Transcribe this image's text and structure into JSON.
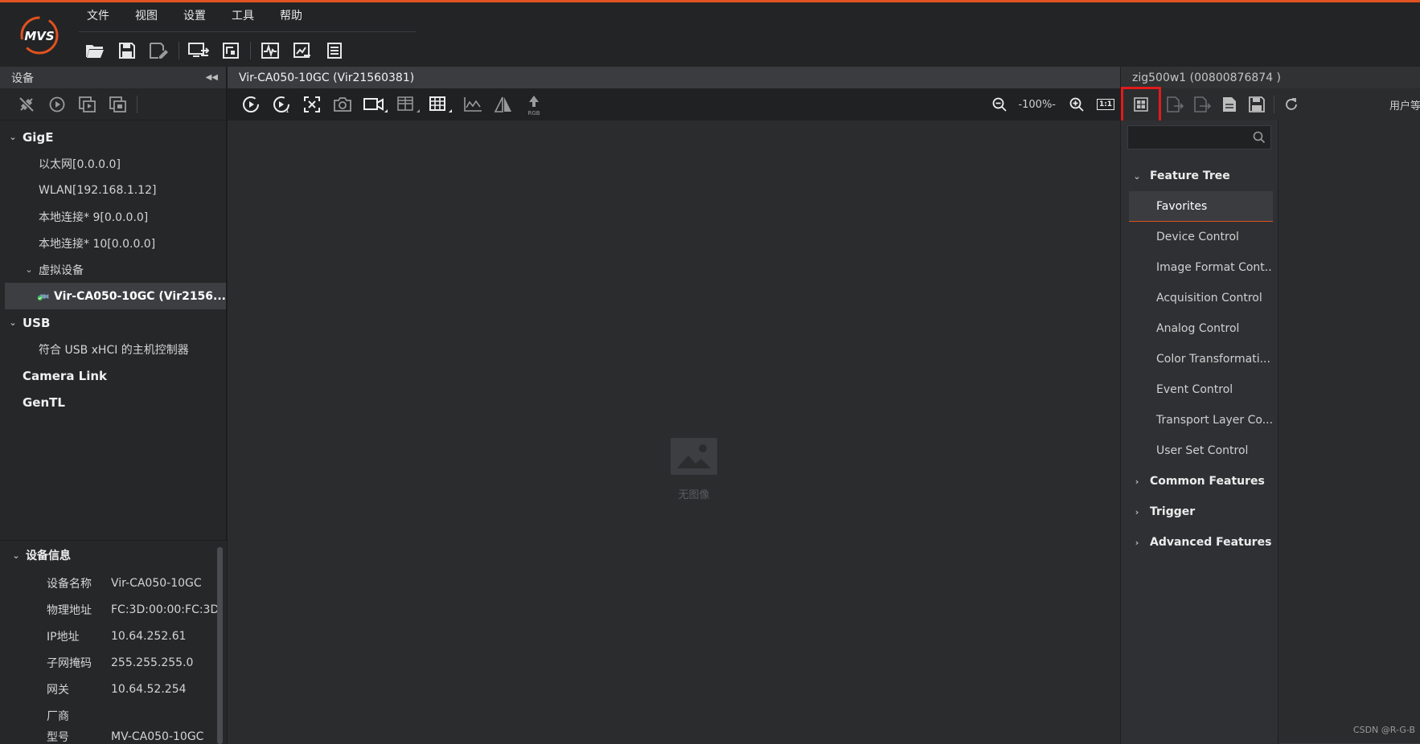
{
  "menu": [
    "文件",
    "视图",
    "设置",
    "工具",
    "帮助"
  ],
  "left_panel": {
    "title": "设备",
    "tree": [
      {
        "label": "GigE",
        "level": 0,
        "type": "group",
        "expanded": true
      },
      {
        "label": "以太网[0.0.0.0]",
        "level": 1
      },
      {
        "label": "WLAN[192.168.1.12]",
        "level": 1
      },
      {
        "label": "本地连接* 9[0.0.0.0]",
        "level": 1
      },
      {
        "label": "本地连接* 10[0.0.0.0]",
        "level": 1
      },
      {
        "label": "虚拟设备",
        "level": 1,
        "expanded": true
      },
      {
        "label": "Vir-CA050-10GC (Vir2156...",
        "level": 2,
        "selected": true
      },
      {
        "label": "USB",
        "level": 0,
        "type": "group",
        "expanded": true
      },
      {
        "label": "符合 USB xHCI 的主机控制器",
        "level": 1
      },
      {
        "label": "Camera Link",
        "level": 0,
        "type": "group"
      },
      {
        "label": "GenTL",
        "level": 0,
        "type": "group"
      }
    ],
    "info": {
      "title": "设备信息",
      "rows": [
        {
          "key": "设备名称",
          "value": "Vir-CA050-10GC"
        },
        {
          "key": "物理地址",
          "value": "FC:3D:00:00:FC:3D"
        },
        {
          "key": "IP地址",
          "value": "10.64.252.61"
        },
        {
          "key": "子网掩码",
          "value": "255.255.255.0"
        },
        {
          "key": "网关",
          "value": "10.64.52.254"
        },
        {
          "key": "厂商",
          "value": ""
        },
        {
          "key": "型号",
          "value": "MV-CA050-10GC"
        }
      ]
    }
  },
  "center": {
    "title": "Vir-CA050-10GC (Vir21560381)",
    "zoom": "-100%-",
    "one_to_one": "1:1",
    "rgb_label": "RGB",
    "no_image": "无图像"
  },
  "right_panel": {
    "title": "zig500w1  (00800876874 )",
    "user_label": "用户等",
    "search_placeholder": "",
    "feature_tree": {
      "title": "Feature Tree",
      "items": [
        "Favorites",
        "Device Control",
        "Image Format Cont...",
        "Acquisition Control",
        "Analog Control",
        "Color Transformati...",
        "Event Control",
        "Transport Layer Co...",
        "User Set Control"
      ],
      "groups": [
        "Common Features",
        "Trigger",
        "Advanced Features"
      ]
    }
  },
  "watermark": "CSDN @R-G-B",
  "colors": {
    "accent": "#e0521f",
    "highlight": "#e21b1b",
    "online": "#3cba54"
  }
}
